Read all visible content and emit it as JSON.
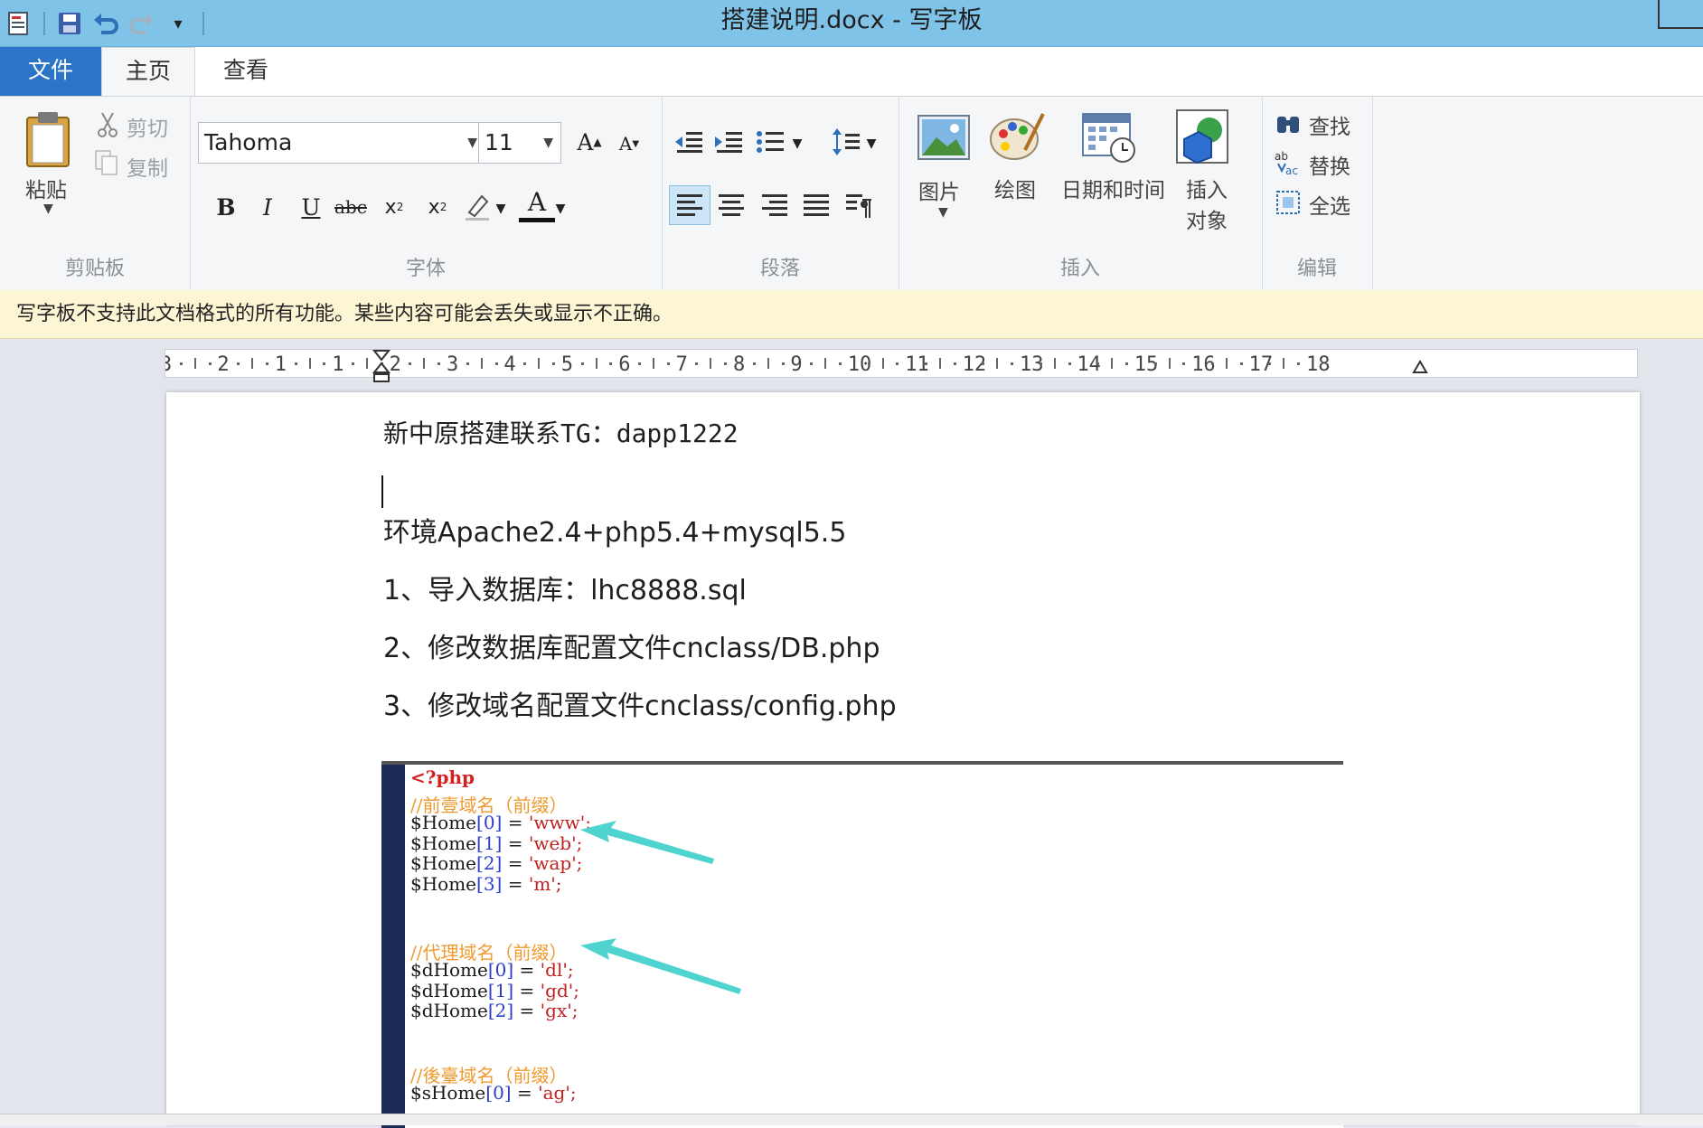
{
  "window": {
    "title": "搭建说明.docx - 写字板"
  },
  "qat": {
    "icons": [
      "app-menu-icon",
      "save-icon",
      "undo-icon",
      "redo-icon",
      "customize-icon"
    ]
  },
  "tabs": [
    {
      "label": "文件"
    },
    {
      "label": "主页"
    },
    {
      "label": "查看"
    }
  ],
  "ribbon": {
    "clipboard": {
      "paste_label": "粘贴",
      "cut_label": "剪切",
      "copy_label": "复制",
      "group_label": "剪贴板"
    },
    "font": {
      "font_family": "Tahoma",
      "font_size": "11",
      "group_label": "字体"
    },
    "paragraph": {
      "group_label": "段落"
    },
    "insert": {
      "picture_label": "图片",
      "paint_label": "绘图",
      "datetime_label": "日期和时间",
      "object_label_1": "插入",
      "object_label_2": "对象",
      "group_label": "插入"
    },
    "edit": {
      "find_label": "查找",
      "replace_label": "替换",
      "select_all_label": "全选",
      "group_label": "编辑"
    }
  },
  "infobar": {
    "message": "写字板不支持此文档格式的所有功能。某些内容可能会丢失或显示不正确。"
  },
  "ruler": {
    "labels": [
      "3",
      "2",
      "1",
      "1",
      "2",
      "3",
      "4",
      "5",
      "6",
      "7",
      "8",
      "9",
      "10",
      "11",
      "12",
      "13",
      "14",
      "15",
      "16",
      "17",
      "18"
    ]
  },
  "document": {
    "lines": [
      "新中原搭建联系TG：dapp1222",
      "环境Apache2.4+php5.4+mysql5.5",
      "1、导入数据库：lhc8888.sql",
      "2、修改数据库配置文件cnclass/DB.php",
      "3、修改域名配置文件cnclass/config.php"
    ]
  },
  "code": {
    "open_tag": "<?php",
    "comment_1": "//前壹域名（前缀）",
    "home": [
      {
        "var": "$Home",
        "idx": "[0]",
        "val": "'www';"
      },
      {
        "var": "$Home",
        "idx": "[1]",
        "val": "'web';"
      },
      {
        "var": "$Home",
        "idx": "[2]",
        "val": "'wap';"
      },
      {
        "var": "$Home",
        "idx": "[3]",
        "val": "'m';"
      }
    ],
    "comment_2": "//代理域名（前缀）",
    "dhome": [
      {
        "var": "$dHome",
        "idx": "[0]",
        "val": "'dl';"
      },
      {
        "var": "$dHome",
        "idx": "[1]",
        "val": "'gd';"
      },
      {
        "var": "$dHome",
        "idx": "[2]",
        "val": "'gx';"
      }
    ],
    "comment_3": "//後臺域名（前缀）",
    "shome": [
      {
        "var": "$sHome",
        "idx": "[0]",
        "val": "'ag';"
      }
    ],
    "eq": " = "
  },
  "colors": {
    "titlebar": "#7fc3e8",
    "file_tab": "#2b74c7",
    "infobar": "#fdf6d5",
    "arrow": "#4fd3cf",
    "code_gutter": "#1b2a57"
  }
}
